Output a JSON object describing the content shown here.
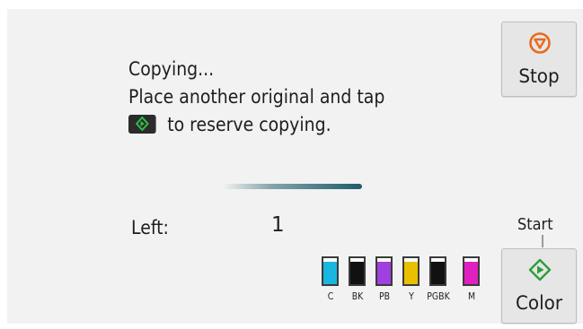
{
  "message": {
    "line1": "Copying...",
    "line2": "Place another original and tap",
    "line3": "to reserve copying.",
    "inline_icon": "start-diamond-icon"
  },
  "progress": {
    "state": "indeterminate"
  },
  "remaining": {
    "label": "Left:",
    "value": "1"
  },
  "ink": [
    {
      "label": "C",
      "color": "#19b7e0",
      "level": 0.85
    },
    {
      "label": "BK",
      "color": "#111111",
      "level": 0.85
    },
    {
      "label": "PB",
      "color": "#a040e0",
      "level": 0.85
    },
    {
      "label": "Y",
      "color": "#e8c000",
      "level": 0.85
    },
    {
      "label": "PGBK",
      "color": "#111111",
      "level": 0.85
    },
    {
      "label": "M",
      "color": "#e020c0",
      "level": 0.85
    }
  ],
  "buttons": {
    "stop": {
      "label": "Stop",
      "icon": "stop-icon",
      "color": "#e86a1e"
    },
    "start_caption": "Start",
    "color": {
      "label": "Color",
      "icon": "start-diamond-icon",
      "color": "#2e9e3a"
    }
  }
}
